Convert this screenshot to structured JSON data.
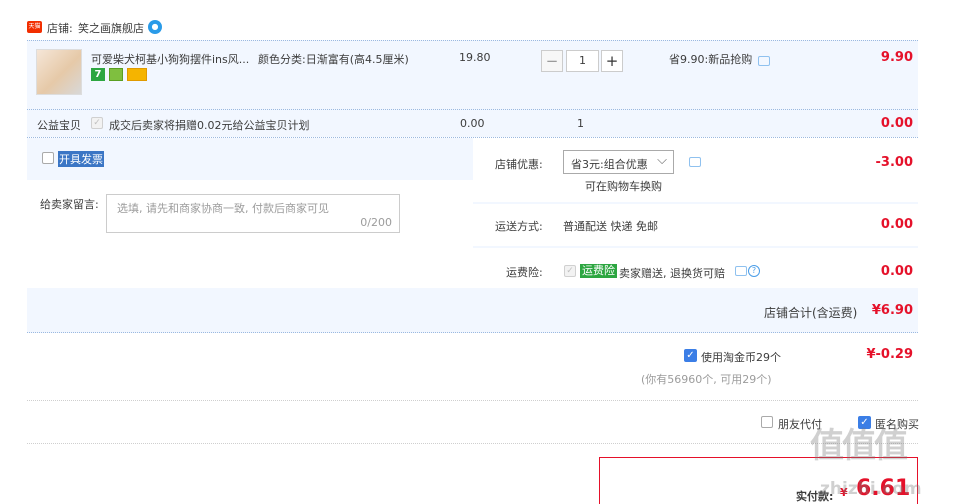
{
  "shop": {
    "badge": "天猫",
    "label": "店铺:",
    "name": "笑之画旗舰店"
  },
  "item": {
    "title": "可爱柴犬柯基小狗狗摆件ins风...",
    "spec": "颜色分类:日渐富有(高4.5厘米)",
    "price": "19.80",
    "qty": "1",
    "promo": "省9.90:新品抢购",
    "total": "9.90",
    "badge_7": "7"
  },
  "charity": {
    "label": "公益宝贝",
    "text": "成交后卖家将捐赠0.02元给公益宝贝计划",
    "price": "0.00",
    "qty": "1",
    "total": "0.00"
  },
  "invoice": {
    "label": "开具发票"
  },
  "message": {
    "label": "给卖家留言:",
    "placeholder": "选填, 请先和商家协商一致, 付款后商家可见",
    "count": "0/200"
  },
  "coupon": {
    "label": "店铺优惠:",
    "selected": "省3元:组合优惠",
    "hint": "可在购物车换购",
    "amount": "-3.00"
  },
  "shipping": {
    "label": "运送方式:",
    "method": "普通配送 快递 免邮",
    "amount": "0.00"
  },
  "insurance": {
    "label": "运费险:",
    "badge": "运费险",
    "text": "卖家赠送, 退换货可赔",
    "amount": "0.00"
  },
  "shop_total": {
    "label": "店铺合计(含运费)",
    "amount": "¥6.90"
  },
  "coins": {
    "label": "使用淘金币29个",
    "detail": "(你有56960个, 可用29个)",
    "amount": "¥-0.29"
  },
  "options": {
    "friend_pay": "朋友代付",
    "anonymous": "匿名购买"
  },
  "pay": {
    "label": "实付款:",
    "currency": "¥",
    "amount": "6.61"
  },
  "watermark": {
    "logo": "值值值",
    "url": "zhizhi.com"
  }
}
